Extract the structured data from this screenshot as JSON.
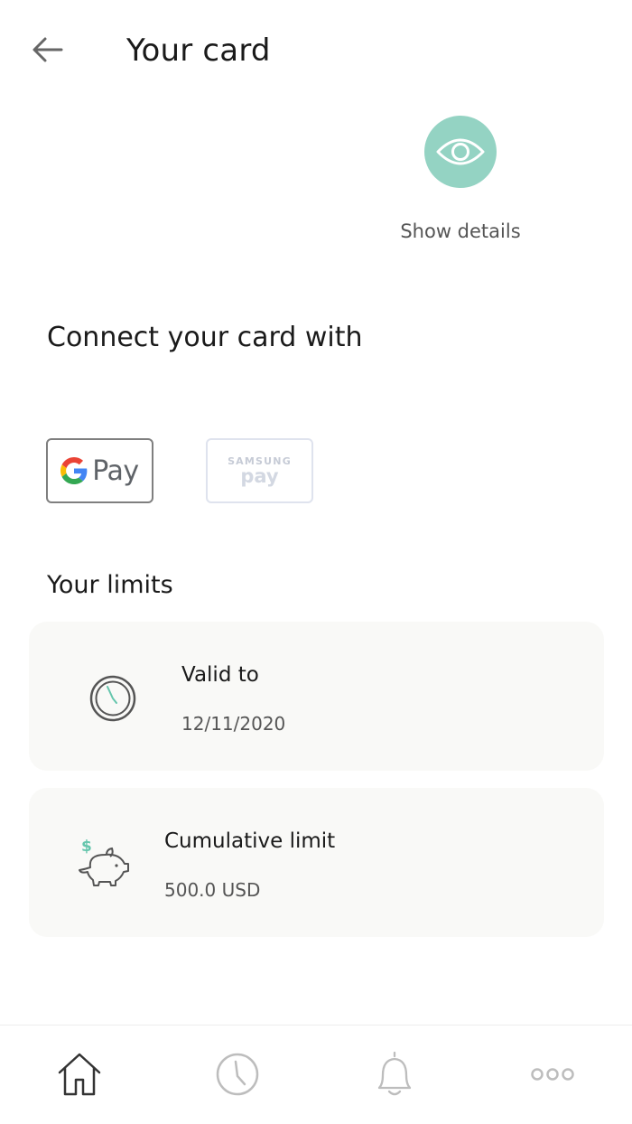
{
  "header": {
    "title": "Your card",
    "back_icon": "arrow-left-icon"
  },
  "details": {
    "label": "Show details",
    "icon": "eye-icon",
    "accent_color": "#94d3c3"
  },
  "connect": {
    "title": "Connect your card with",
    "google_pay": {
      "label": "Pay",
      "icon": "google-g-icon"
    },
    "samsung_pay": {
      "top_label": "SAMSUNG",
      "bottom_label": "pay"
    }
  },
  "limits": {
    "title": "Your limits",
    "valid_to": {
      "label": "Valid to",
      "value": "12/11/2020",
      "icon": "clock-icon"
    },
    "cumulative": {
      "label": "Cumulative limit",
      "value": "500.0 USD",
      "icon": "piggy-bank-icon"
    }
  },
  "bottom_nav": {
    "items": [
      {
        "icon": "home-icon"
      },
      {
        "icon": "clock-icon"
      },
      {
        "icon": "bell-icon"
      },
      {
        "icon": "more-icon"
      }
    ]
  }
}
